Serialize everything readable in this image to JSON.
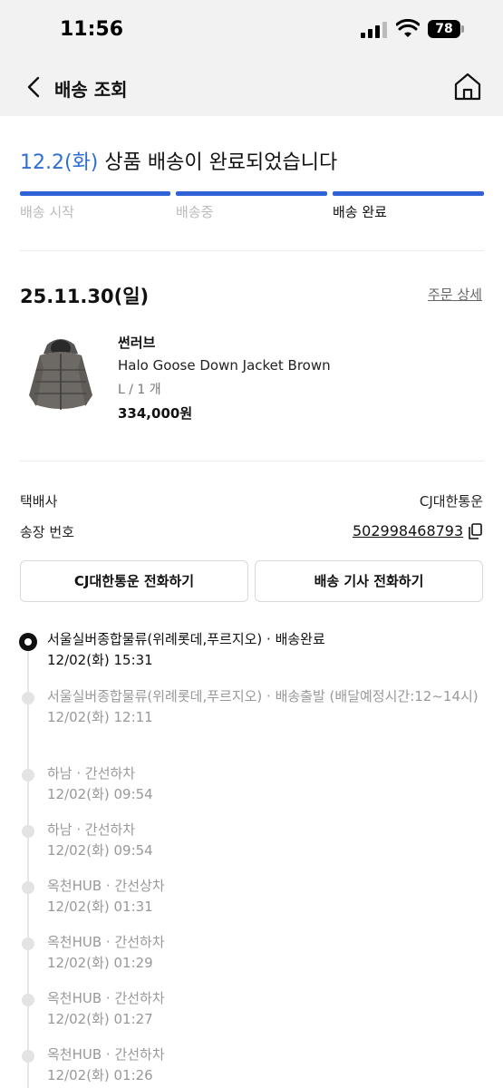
{
  "status_bar": {
    "time": "11:56",
    "battery": "78"
  },
  "header": {
    "title": "배송 조회",
    "back_icon": "chevron-left-icon",
    "home_icon": "home-icon"
  },
  "delivery": {
    "date": "12.2(화)",
    "message": " 상품 배송이 완료되었습니다",
    "steps": [
      {
        "label": "배송 시작",
        "active": false
      },
      {
        "label": "배송중",
        "active": false
      },
      {
        "label": "배송 완료",
        "active": true
      }
    ],
    "progress_color": "#2e62d6"
  },
  "order": {
    "date": "25.11.30(일)",
    "detail_link": "주문 상세",
    "product": {
      "brand": "썬러브",
      "name": "Halo Goose Down Jacket Brown",
      "option": "L / 1 개",
      "price": "334,000원"
    }
  },
  "shipping": {
    "carrier_label": "택배사",
    "carrier": "CJ대한통운",
    "tracking_label": "송장 번호",
    "tracking_number": "502998468793",
    "call_carrier_button": "CJ대한통운 전화하기",
    "call_driver_button": "배송 기사 전화하기"
  },
  "timeline": [
    {
      "desc": "서울실버종합물류(위례롯데,푸르지오) · 배송완료",
      "time": "12/02(화) 15:31",
      "current": true
    },
    {
      "desc": "서울실버종합물류(위례롯데,푸르지오) · 배송출발 (배달예정시간:12~14시)",
      "time": "12/02(화) 12:11",
      "current": false
    },
    {
      "desc": "하남 · 간선하차",
      "time": "12/02(화) 09:54",
      "current": false
    },
    {
      "desc": "하남 · 간선하차",
      "time": "12/02(화) 09:54",
      "current": false
    },
    {
      "desc": "옥천HUB · 간선상차",
      "time": "12/02(화) 01:31",
      "current": false
    },
    {
      "desc": "옥천HUB · 간선하차",
      "time": "12/02(화) 01:29",
      "current": false
    },
    {
      "desc": "옥천HUB · 간선하차",
      "time": "12/02(화) 01:27",
      "current": false
    },
    {
      "desc": "옥천HUB · 간선하차",
      "time": "12/02(화) 01:26",
      "current": false
    }
  ]
}
